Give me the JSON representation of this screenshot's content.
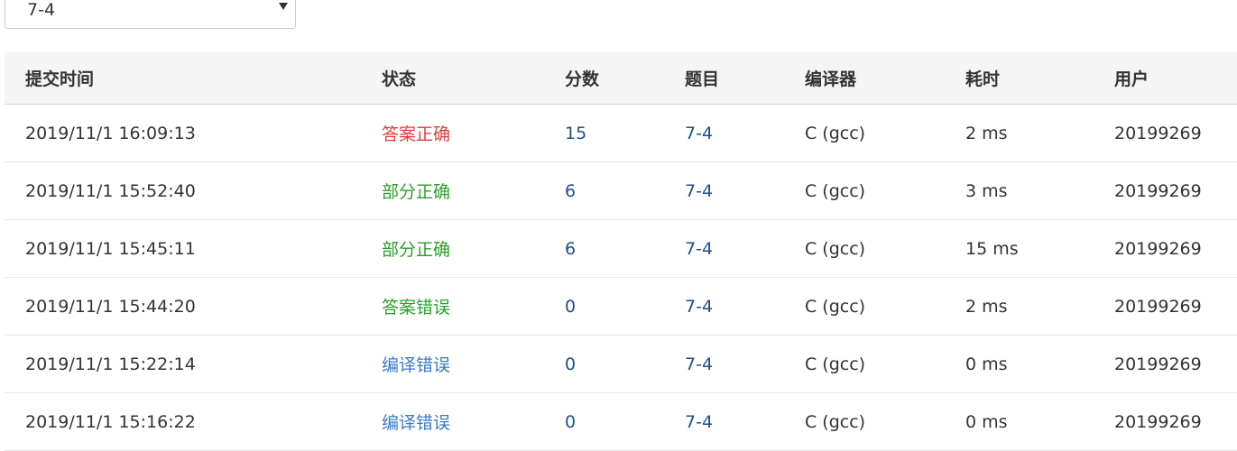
{
  "filter": {
    "problem_select": "7-4"
  },
  "table": {
    "headers": [
      "提交时间",
      "状态",
      "分数",
      "题目",
      "编译器",
      "耗时",
      "用户"
    ],
    "rows": [
      {
        "time": "2019/11/1 16:09:13",
        "status": "答案正确",
        "status_kind": "accepted",
        "score": "15",
        "problem": "7-4",
        "compiler": "C (gcc)",
        "duration": "2 ms",
        "user": "20199269"
      },
      {
        "time": "2019/11/1 15:52:40",
        "status": "部分正确",
        "status_kind": "partial",
        "score": "6",
        "problem": "7-4",
        "compiler": "C (gcc)",
        "duration": "3 ms",
        "user": "20199269"
      },
      {
        "time": "2019/11/1 15:45:11",
        "status": "部分正确",
        "status_kind": "partial",
        "score": "6",
        "problem": "7-4",
        "compiler": "C (gcc)",
        "duration": "15 ms",
        "user": "20199269"
      },
      {
        "time": "2019/11/1 15:44:20",
        "status": "答案错误",
        "status_kind": "wrong",
        "score": "0",
        "problem": "7-4",
        "compiler": "C (gcc)",
        "duration": "2 ms",
        "user": "20199269"
      },
      {
        "time": "2019/11/1 15:22:14",
        "status": "编译错误",
        "status_kind": "compile",
        "score": "0",
        "problem": "7-4",
        "compiler": "C (gcc)",
        "duration": "0 ms",
        "user": "20199269"
      },
      {
        "time": "2019/11/1 15:16:22",
        "status": "编译错误",
        "status_kind": "compile",
        "score": "0",
        "problem": "7-4",
        "compiler": "C (gcc)",
        "duration": "0 ms",
        "user": "20199269"
      }
    ]
  },
  "colors": {
    "accepted": "#e03c3c",
    "partial": "#2ca02c",
    "wrong": "#2ca02c",
    "compile": "#3a7bc8",
    "link": "#1f4e8c",
    "header_bg": "#f5f5f5"
  },
  "icons": {
    "select_arrow": "triangle-down-icon"
  }
}
